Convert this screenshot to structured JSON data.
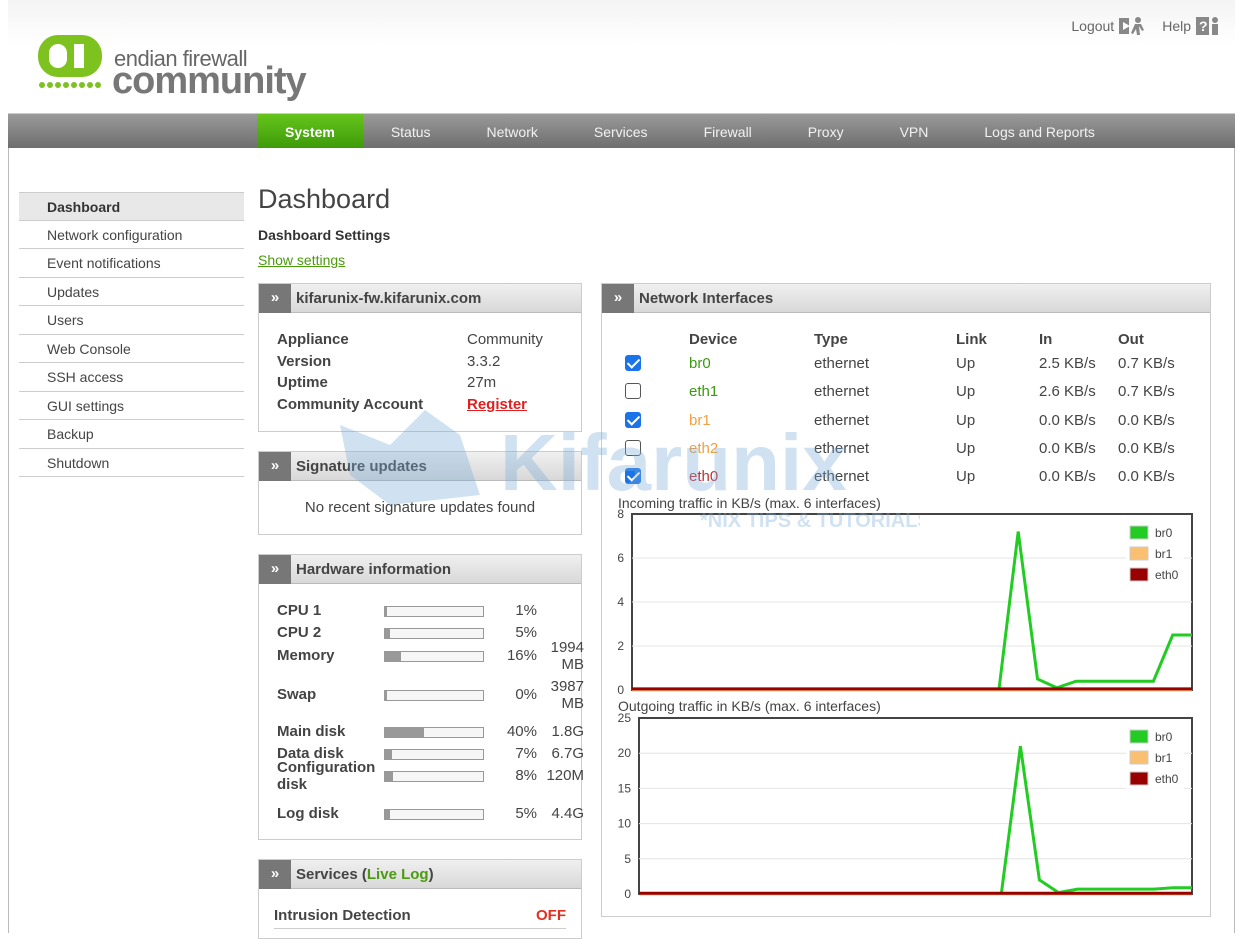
{
  "brand": {
    "line1": "endian firewall",
    "line2": "community"
  },
  "toplinks": {
    "logout": "Logout",
    "help": "Help"
  },
  "nav": {
    "tabs": [
      "System",
      "Status",
      "Network",
      "Services",
      "Firewall",
      "Proxy",
      "VPN",
      "Logs and Reports"
    ],
    "active": "System"
  },
  "sidebar": {
    "items": [
      "Dashboard",
      "Network configuration",
      "Event notifications",
      "Updates",
      "Users",
      "Web Console",
      "SSH access",
      "GUI settings",
      "Backup",
      "Shutdown"
    ]
  },
  "page": {
    "title": "Dashboard",
    "settings_title": "Dashboard Settings",
    "show_settings": "Show settings"
  },
  "appliance": {
    "header": "kifarunix-fw.kifarunix.com",
    "rows": [
      {
        "label": "Appliance",
        "value": "Community"
      },
      {
        "label": "Version",
        "value": "3.3.2"
      },
      {
        "label": "Uptime",
        "value": "27m"
      },
      {
        "label": "Community Account",
        "value": "Register"
      }
    ]
  },
  "signature": {
    "header": "Signature updates",
    "text": "No recent signature updates found"
  },
  "hardware": {
    "header": "Hardware information",
    "rows": [
      {
        "label": "CPU 1",
        "pct_text": "1%",
        "pct": 1,
        "size": ""
      },
      {
        "label": "CPU 2",
        "pct_text": "5%",
        "pct": 5,
        "size": ""
      },
      {
        "label": "Memory",
        "pct_text": "16%",
        "pct": 16,
        "size": "1994 MB"
      },
      {
        "label": "Swap",
        "pct_text": "0%",
        "pct": 0,
        "size": "3987 MB"
      },
      {
        "label": "Main disk",
        "pct_text": "40%",
        "pct": 40,
        "size": "1.8G"
      },
      {
        "label": "Data disk",
        "pct_text": "7%",
        "pct": 7,
        "size": "6.7G"
      },
      {
        "label": "Configuration disk",
        "pct_text": "8%",
        "pct": 8,
        "size": "120M"
      },
      {
        "label": "Log disk",
        "pct_text": "5%",
        "pct": 5,
        "size": "4.4G"
      }
    ]
  },
  "services": {
    "header_pre": "Services (",
    "live_log": "Live Log",
    "header_post": ")",
    "rows": [
      {
        "label": "Intrusion Detection",
        "status": "OFF"
      }
    ]
  },
  "network": {
    "header": "Network Interfaces",
    "columns": [
      "Device",
      "Type",
      "Link",
      "In",
      "Out"
    ],
    "rows": [
      {
        "checked": true,
        "device": "br0",
        "color": "#3a9a10",
        "type": "ethernet",
        "link": "Up",
        "in": "2.5 KB/s",
        "out": "0.7 KB/s"
      },
      {
        "checked": false,
        "device": "eth1",
        "color": "#3a9a10",
        "type": "ethernet",
        "link": "Up",
        "in": "2.6 KB/s",
        "out": "0.7 KB/s"
      },
      {
        "checked": true,
        "device": "br1",
        "color": "#f0a040",
        "type": "ethernet",
        "link": "Up",
        "in": "0.0 KB/s",
        "out": "0.0 KB/s"
      },
      {
        "checked": false,
        "device": "eth2",
        "color": "#f0a040",
        "type": "ethernet",
        "link": "Up",
        "in": "0.0 KB/s",
        "out": "0.0 KB/s"
      },
      {
        "checked": true,
        "device": "eth0",
        "color": "#c03030",
        "type": "ethernet",
        "link": "Up",
        "in": "0.0 KB/s",
        "out": "0.0 KB/s"
      }
    ]
  },
  "watermark": {
    "brand": "Kifarunix",
    "tagline": "*NIX TIPS & TUTORIALS"
  },
  "chart_data": [
    {
      "type": "line",
      "title": "Incoming traffic in KB/s (max. 6 interfaces)",
      "ylim": [
        0,
        8
      ],
      "yticks": [
        "0",
        "2",
        "4",
        "6",
        "8"
      ],
      "x": [
        0,
        1,
        2,
        3,
        4,
        5,
        6,
        7,
        8,
        9,
        10,
        11,
        12,
        13,
        14,
        15,
        16,
        17,
        18,
        19,
        20,
        21,
        22,
        23,
        24,
        25,
        26,
        27,
        28,
        29
      ],
      "series": [
        {
          "name": "br0",
          "color": "#22cc22",
          "values": [
            0,
            0,
            0,
            0,
            0,
            0,
            0,
            0,
            0,
            0,
            0,
            0,
            0,
            0,
            0,
            0,
            0,
            0,
            0,
            0,
            7.2,
            0.5,
            0.1,
            0.4,
            0.4,
            0.4,
            0.4,
            0.4,
            2.5,
            2.5
          ]
        },
        {
          "name": "br1",
          "color": "#f8c070",
          "values": [
            0,
            0,
            0,
            0,
            0,
            0,
            0,
            0,
            0,
            0,
            0,
            0,
            0,
            0,
            0,
            0,
            0,
            0,
            0,
            0,
            0,
            0,
            0,
            0,
            0,
            0,
            0,
            0,
            0,
            0
          ]
        },
        {
          "name": "eth0",
          "color": "#990000",
          "values": [
            0.05,
            0.05,
            0.05,
            0.05,
            0.05,
            0.05,
            0.05,
            0.05,
            0.05,
            0.05,
            0.05,
            0.05,
            0.05,
            0.05,
            0.05,
            0.05,
            0.05,
            0.05,
            0.05,
            0.05,
            0.05,
            0.05,
            0.05,
            0.05,
            0.05,
            0.05,
            0.05,
            0.05,
            0.05,
            0.05
          ]
        }
      ]
    },
    {
      "type": "line",
      "title": "Outgoing traffic in KB/s (max. 6 interfaces)",
      "ylim": [
        0,
        25
      ],
      "yticks": [
        "0",
        "5",
        "10",
        "15",
        "20",
        "25"
      ],
      "x": [
        0,
        1,
        2,
        3,
        4,
        5,
        6,
        7,
        8,
        9,
        10,
        11,
        12,
        13,
        14,
        15,
        16,
        17,
        18,
        19,
        20,
        21,
        22,
        23,
        24,
        25,
        26,
        27,
        28,
        29
      ],
      "series": [
        {
          "name": "br0",
          "color": "#22cc22",
          "values": [
            0,
            0,
            0,
            0,
            0,
            0,
            0,
            0,
            0,
            0,
            0,
            0,
            0,
            0,
            0,
            0,
            0,
            0,
            0,
            0,
            21,
            2,
            0.2,
            0.7,
            0.7,
            0.7,
            0.7,
            0.7,
            0.9,
            0.9
          ]
        },
        {
          "name": "br1",
          "color": "#f8c070",
          "values": [
            0,
            0,
            0,
            0,
            0,
            0,
            0,
            0,
            0,
            0,
            0,
            0,
            0,
            0,
            0,
            0,
            0,
            0,
            0,
            0,
            0,
            0,
            0,
            0,
            0,
            0,
            0,
            0,
            0,
            0
          ]
        },
        {
          "name": "eth0",
          "color": "#990000",
          "values": [
            0.1,
            0.1,
            0.1,
            0.1,
            0.1,
            0.1,
            0.1,
            0.1,
            0.1,
            0.1,
            0.1,
            0.1,
            0.1,
            0.1,
            0.1,
            0.1,
            0.1,
            0.1,
            0.1,
            0.1,
            0.1,
            0.1,
            0.1,
            0.1,
            0.1,
            0.1,
            0.1,
            0.1,
            0.1,
            0.1
          ]
        }
      ]
    }
  ]
}
